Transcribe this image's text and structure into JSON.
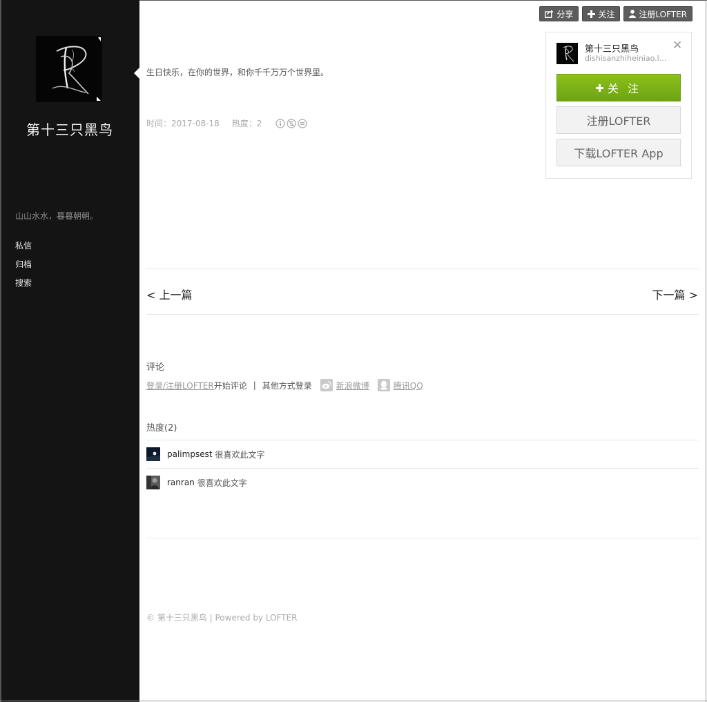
{
  "blog": {
    "name": "第十三只黑鸟",
    "description": "山山水水，暮暮朝朝。",
    "nav": [
      "私信",
      "归档",
      "搜索"
    ]
  },
  "topbar": {
    "share": "分享",
    "follow": "关注",
    "register": "注册LOFTER"
  },
  "card": {
    "name": "第十三只黑鸟",
    "domain": "dishisanzhiheiniao.l...",
    "close": "✕",
    "follow_label": "关 注",
    "register_label": "注册LOFTER",
    "download_label": "下载LOFTER App"
  },
  "post": {
    "text": "生日快乐，在你的世界，和你千千万万个世界里。",
    "time": "时间：2017-08-18",
    "heat": "热度：2"
  },
  "pager": {
    "prev": "< 上一篇",
    "next": "下一篇 >"
  },
  "comments": {
    "title": "评论",
    "login_link": "登录/注册LOFTER",
    "start": " 开始评论",
    "divider": "|",
    "other_login": "其他方式登录",
    "weibo": "新浪微博",
    "qq": "腾讯QQ"
  },
  "heat_section": {
    "title": "热度(2)",
    "likes": [
      {
        "user": "palimpsest",
        "text": "很喜欢此文字"
      },
      {
        "user": "ranran",
        "text": "很喜欢此文字"
      }
    ]
  },
  "footer": {
    "text": "© 第十三只黑鸟 | Powered by LOFTER"
  },
  "colors": {
    "sidebar_bg": "#141414",
    "follow_green": "#7ab317"
  }
}
